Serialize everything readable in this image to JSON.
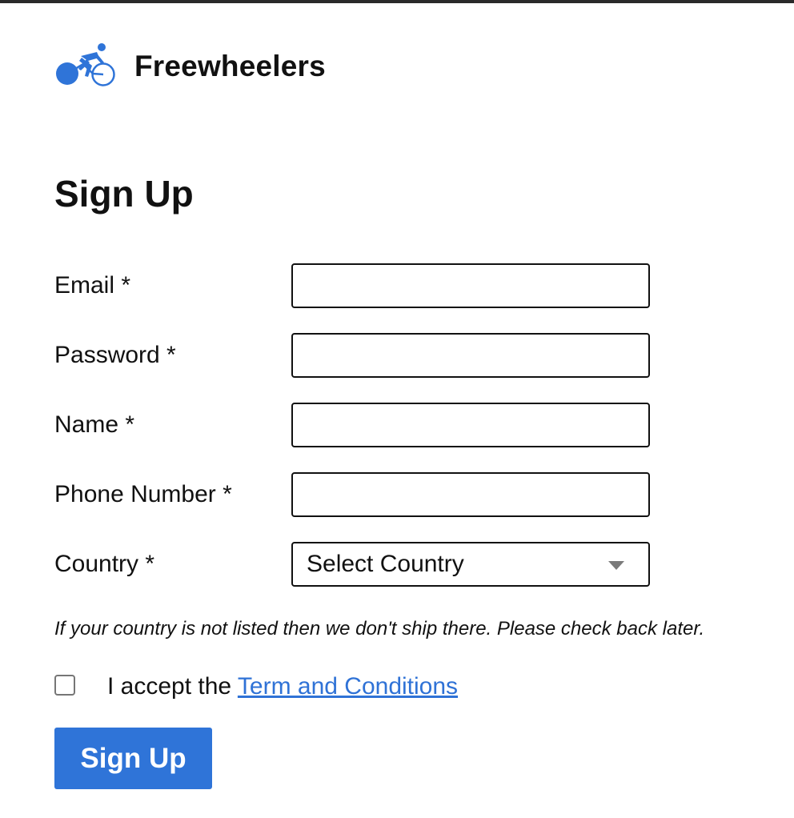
{
  "brand": {
    "name": "Freewheelers",
    "logo_icon": "cyclist-icon",
    "logo_color": "#2f74d8"
  },
  "page": {
    "title": "Sign Up"
  },
  "form": {
    "email": {
      "label": "Email *",
      "value": ""
    },
    "password": {
      "label": "Password *",
      "value": ""
    },
    "name": {
      "label": "Name *",
      "value": ""
    },
    "phone": {
      "label": "Phone Number *",
      "value": ""
    },
    "country": {
      "label": "Country *",
      "selected": "Select Country"
    },
    "note": "If your country is not listed then we don't ship there. Please check back later.",
    "terms": {
      "checked": false,
      "prefix": "I accept the ",
      "link_text": "Term and Conditions"
    },
    "submit_label": "Sign Up"
  },
  "colors": {
    "primary_button": "#2f74d8",
    "link": "#2f72d6"
  }
}
